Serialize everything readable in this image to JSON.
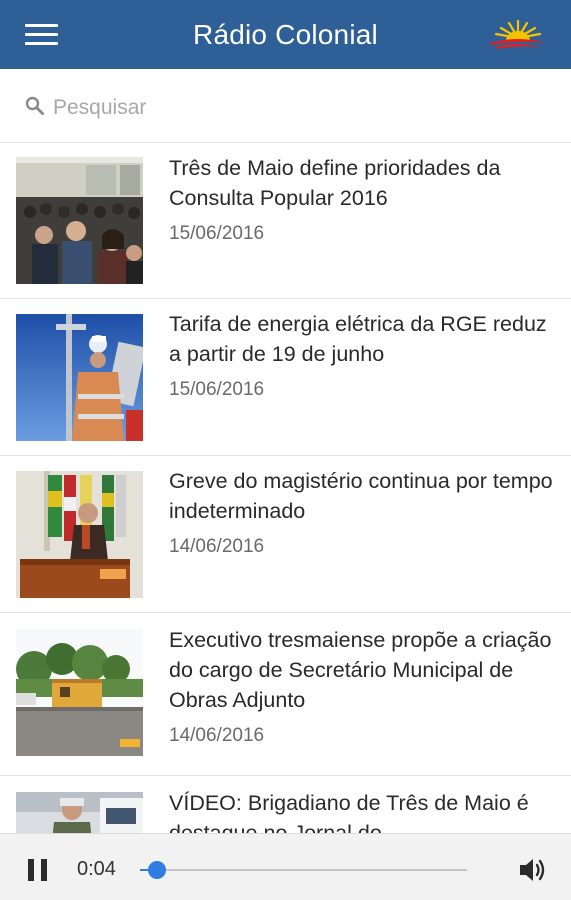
{
  "appbar": {
    "title": "Rádio Colonial",
    "icons": {
      "menu": "hamburger-menu-icon",
      "logo": "sunrise-logo"
    },
    "color": "#2e5f96"
  },
  "search": {
    "placeholder": "Pesquisar",
    "value": ""
  },
  "news": [
    {
      "title": "Três de Maio define prioridades da Consulta Popular 2016",
      "date": "15/06/2016",
      "image": "audience-meeting-photo"
    },
    {
      "title": "Tarifa de energia elétrica da RGE reduz a partir de 19 de junho",
      "date": "15/06/2016",
      "image": "electric-worker-photo"
    },
    {
      "title": "Greve do magistério continua por tempo indeterminado",
      "date": "14/06/2016",
      "image": "speaker-podium-photo"
    },
    {
      "title": "Executivo tresmaiense propõe a criação do cargo de Secretário Municipal de Obras Adjunto",
      "date": "14/06/2016",
      "image": "street-building-photo"
    },
    {
      "title": "VÍDEO: Brigadiano de Três de Maio é destaque no Jornal do",
      "date": "",
      "image": "police-officer-photo"
    }
  ],
  "player": {
    "time": "0:04",
    "progress": 0.025,
    "state": "playing",
    "accent": "#2f7de1"
  }
}
